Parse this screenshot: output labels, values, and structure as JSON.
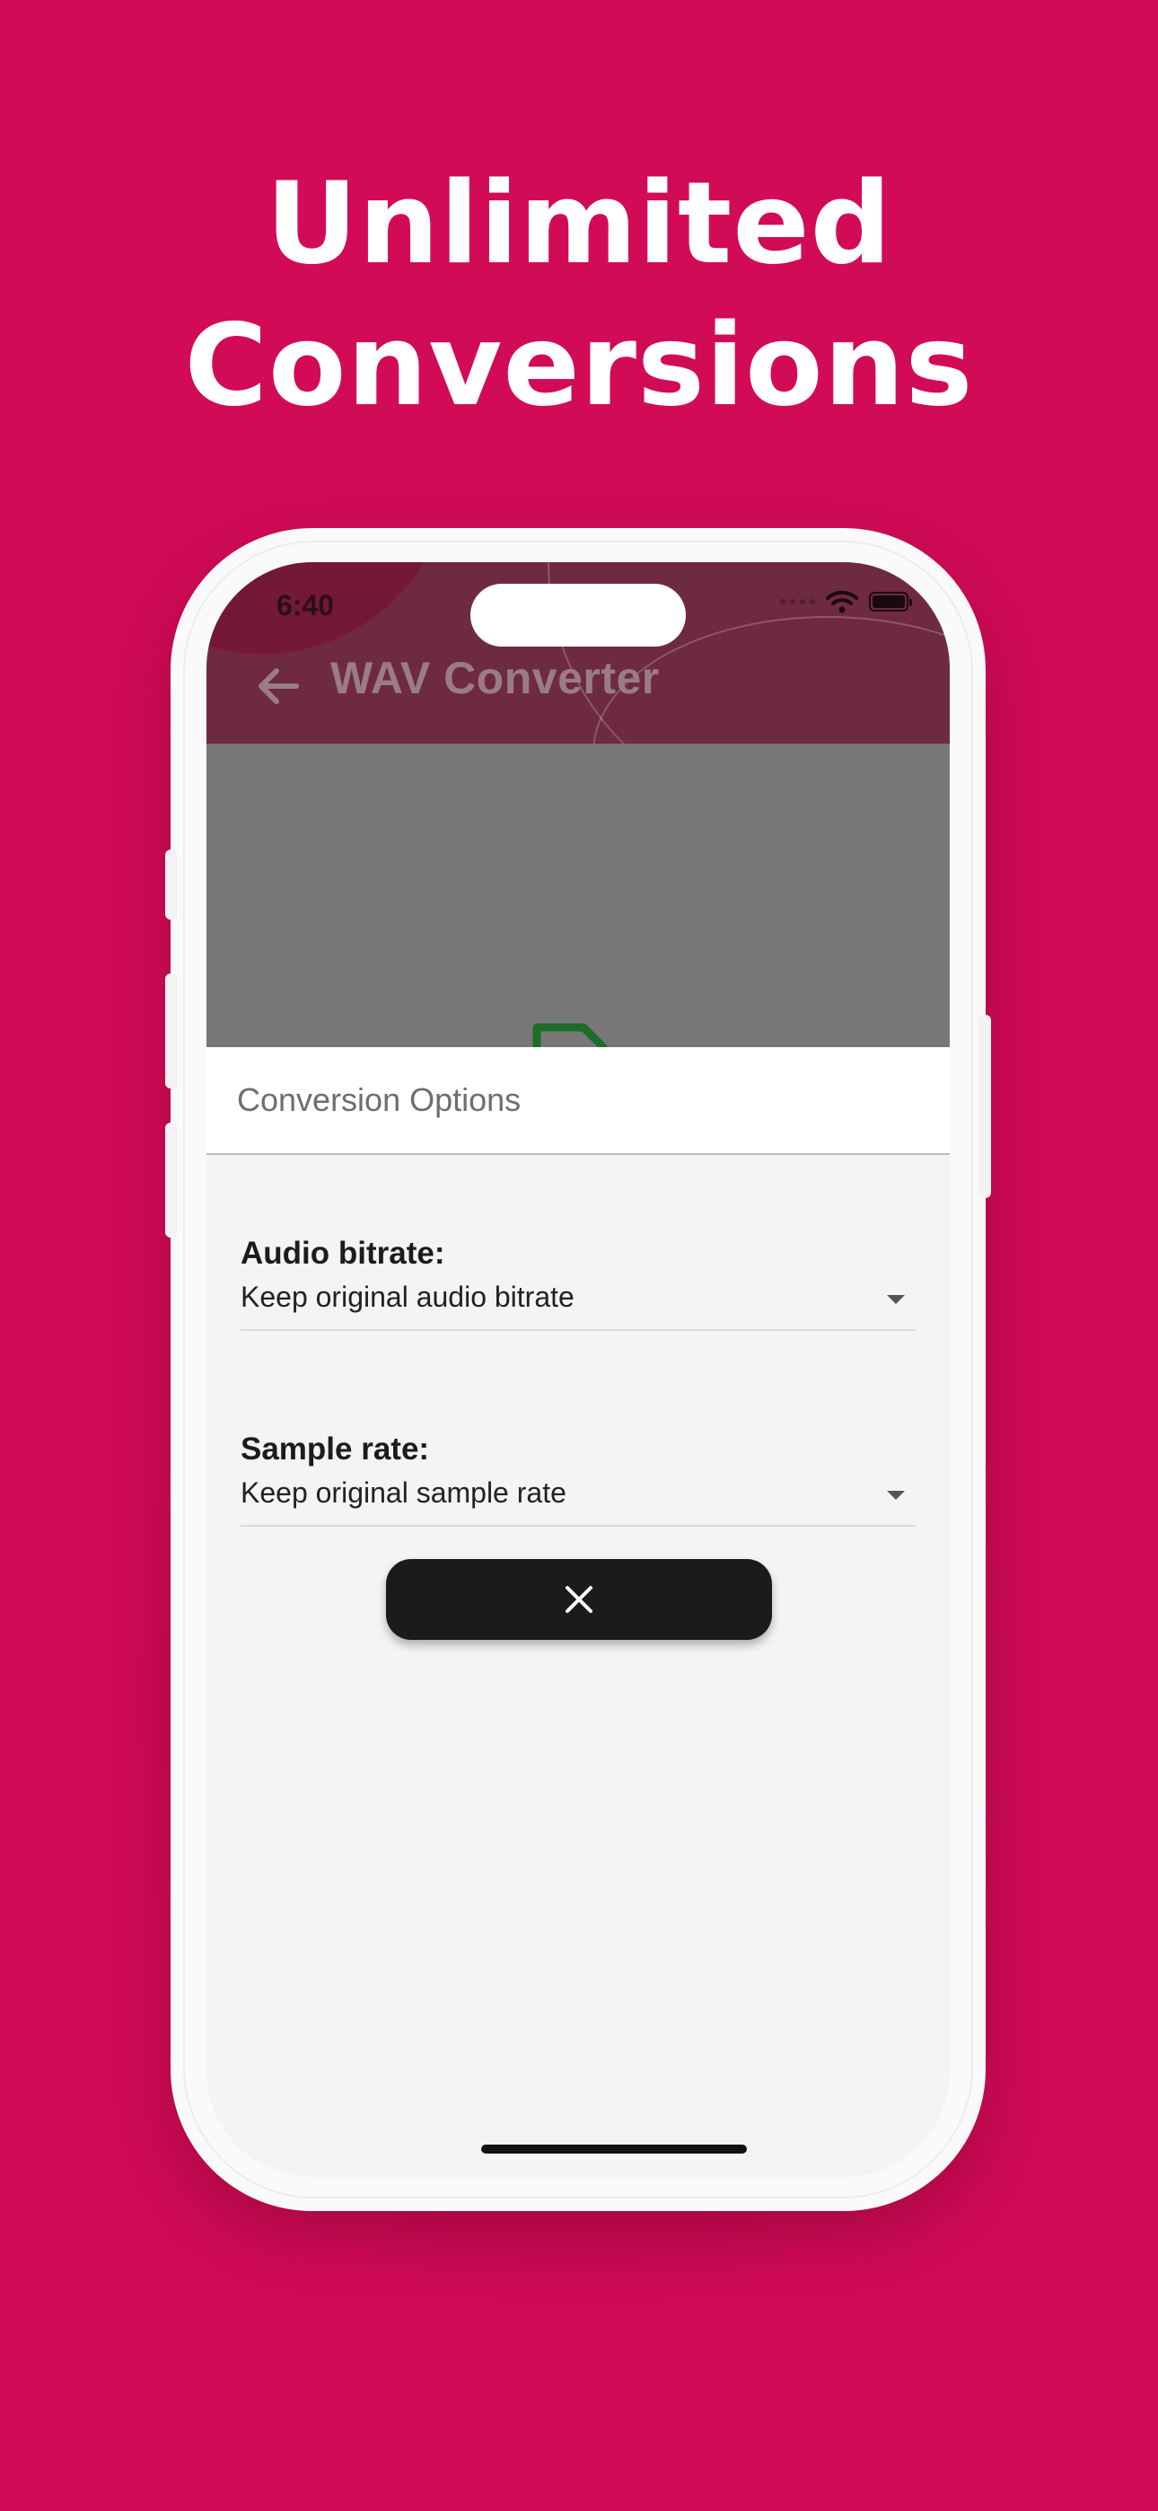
{
  "promo": {
    "headline_line1": "Unlimited",
    "headline_line2": "Conversions",
    "background_color": "#d20b57"
  },
  "status_bar": {
    "time": "6:40",
    "icons": [
      "signal-dots-icon",
      "wifi-icon",
      "battery-icon"
    ]
  },
  "app_bar": {
    "title": "WAV Converter",
    "back_icon": "arrow-left-icon",
    "color": "#6e2a3e"
  },
  "background_icon": "file-icon",
  "sheet": {
    "title": "Conversion Options",
    "audio_bitrate": {
      "label": "Audio bitrate:",
      "selected": "Keep original audio bitrate"
    },
    "sample_rate": {
      "label": "Sample rate:",
      "selected": "Keep original sample rate"
    },
    "close_button": {
      "icon": "close-icon"
    }
  }
}
